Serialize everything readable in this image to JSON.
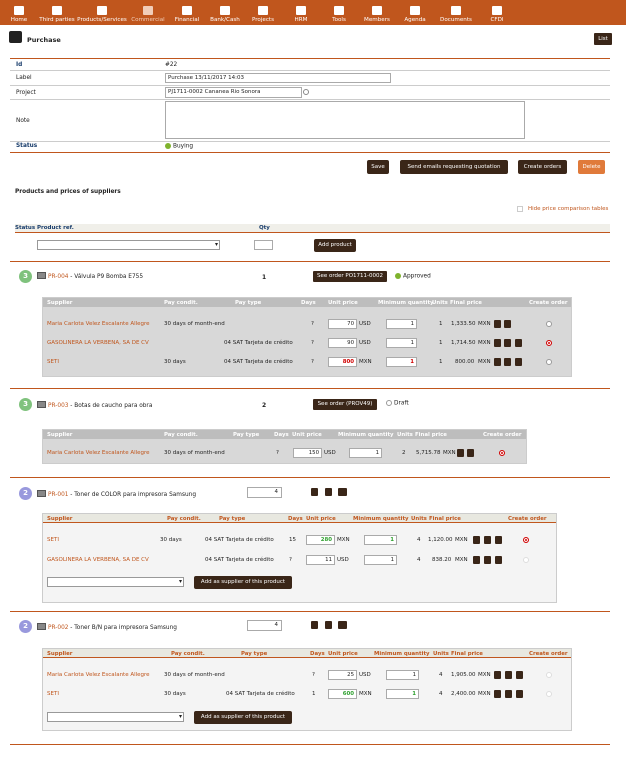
{
  "nav": [
    "Home",
    "Third parties",
    "Products/Services",
    "Commercial",
    "Financial",
    "Bank/Cash",
    "Projects",
    "HRM",
    "Tools",
    "Members",
    "Agenda",
    "Documents",
    "CFDI"
  ],
  "header": {
    "title": "Purchase",
    "list_label": "List"
  },
  "card": {
    "id_label": "Id",
    "id_value": "#22",
    "label_label": "Label",
    "label_value": "Purchase 13/11/2017 14:03",
    "project_label": "Project",
    "project_value": "PJ1711-0002 Cananea Rio Sonora",
    "note_label": "Note",
    "status_label": "Status",
    "status_value": "Buying"
  },
  "actions": {
    "save": "Save",
    "send": "Send emails requesting quotation",
    "create": "Create orders",
    "delete": "Delete"
  },
  "section_title": "Products and prices of suppliers",
  "hide_compare": "Hide price comparison tables",
  "table_head": {
    "status": "Status",
    "product_ref": "Product ref.",
    "qty": "Qty",
    "add_product": "Add product"
  },
  "col": {
    "supplier": "Supplier",
    "pay_cond": "Pay condit.",
    "pay_type": "Pay type",
    "days": "Days",
    "unit_price": "Unit price",
    "min_qty": "Minimum quantity",
    "units": "Units",
    "final_price": "Final price",
    "create_order": "Create order"
  },
  "products": [
    {
      "badge": "3",
      "ref": "PR-004",
      "name": "Válvula P9 Bomba E755",
      "qty": "1",
      "order_btn": "See order PO1711-0002",
      "order_status": "Approved",
      "rows": [
        {
          "supplier": "Maria Carlota Velez Escalante Allegre",
          "pay_cond": "30 days of month-end",
          "pay_type": "",
          "days": "?",
          "price": "70",
          "cur": "USD",
          "min": "1",
          "units": "1",
          "final": "1,333.50",
          "fcur": "MXN"
        },
        {
          "supplier": "GASOLINERA LA VERBENA, SA DE CV",
          "pay_cond": "",
          "pay_type": "04 SAT Tarjeta de crédito",
          "days": "?",
          "price": "90",
          "cur": "USD",
          "min": "1",
          "units": "1",
          "final": "1,714.50",
          "fcur": "MXN"
        },
        {
          "supplier": "SETI",
          "pay_cond": "30 days",
          "pay_type": "04 SAT Tarjeta de crédito",
          "days": "?",
          "price": "800",
          "cur": "MXN",
          "min": "1",
          "units": "1",
          "final": "800.00",
          "fcur": "MXN"
        }
      ]
    },
    {
      "badge": "3",
      "ref": "PR-003",
      "name": "Botas de caucho para obra",
      "qty": "2",
      "order_btn": "See order (PROV49)",
      "order_status": "Draft",
      "rows": [
        {
          "supplier": "Maria Carlota Velez Escalante Allegre",
          "pay_cond": "30 days of month-end",
          "pay_type": "",
          "days": "?",
          "price": "150",
          "cur": "USD",
          "min": "1",
          "units": "2",
          "final": "5,715.78",
          "fcur": "MXN"
        }
      ]
    },
    {
      "badge": "2",
      "ref": "PR-001",
      "name": "Toner de COLOR para impresora Samsung",
      "qty": "4",
      "rows": [
        {
          "supplier": "SETI",
          "pay_cond": "30 days",
          "pay_type": "04 SAT Tarjeta de crédito",
          "days": "15",
          "price": "280",
          "cur": "MXN",
          "min": "1",
          "units": "4",
          "final": "1,120.00",
          "fcur": "MXN"
        },
        {
          "supplier": "GASOLINERA LA VERBENA, SA DE CV",
          "pay_cond": "",
          "pay_type": "04 SAT Tarjeta de crédito",
          "days": "?",
          "price": "11",
          "cur": "USD",
          "min": "1",
          "units": "4",
          "final": "838.20",
          "fcur": "MXN"
        }
      ],
      "add_supplier": "Add as supplier of this product"
    },
    {
      "badge": "2",
      "ref": "PR-002",
      "name": "Toner B/N para impresora Samsung",
      "qty": "4",
      "rows": [
        {
          "supplier": "Maria Carlota Velez Escalante Allegre",
          "pay_cond": "30 days of month-end",
          "pay_type": "",
          "days": "?",
          "price": "25",
          "cur": "USD",
          "min": "1",
          "units": "4",
          "final": "1,905.00",
          "fcur": "MXN"
        },
        {
          "supplier": "SETI",
          "pay_cond": "30 days",
          "pay_type": "04 SAT Tarjeta de crédito",
          "days": "1",
          "price": "600",
          "cur": "MXN",
          "min": "1",
          "units": "4",
          "final": "2,400.00",
          "fcur": "MXN"
        }
      ],
      "add_supplier": "Add as supplier of this product"
    }
  ]
}
